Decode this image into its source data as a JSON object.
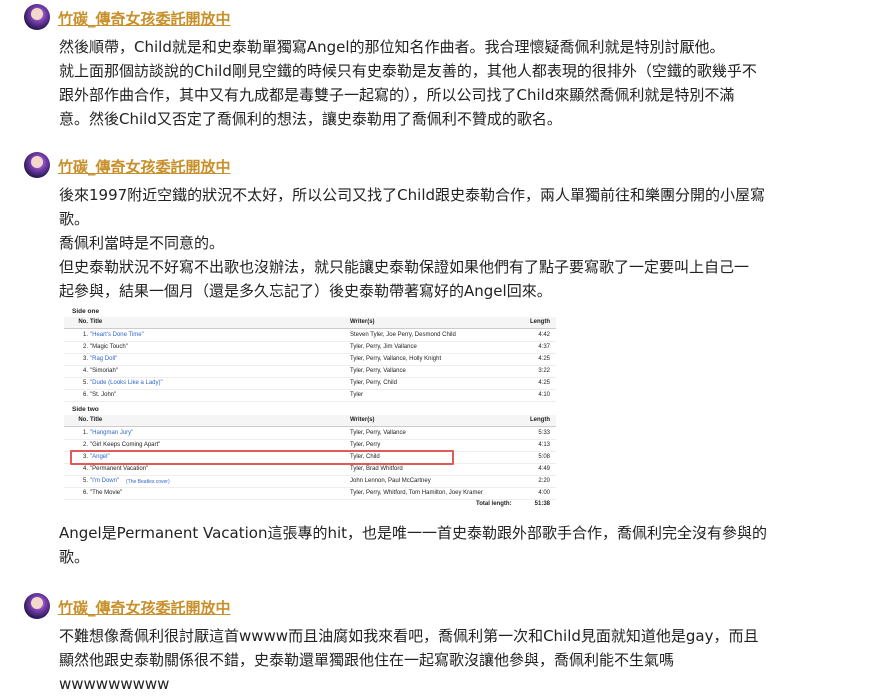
{
  "posts": [
    {
      "author": "竹碳_傳奇女孩委託開放中",
      "paragraphs": [
        "然後順帶，Child就是和史泰勒單獨寫Angel的那位知名作曲者。我合理懷疑喬佩利就是特別討厭他。",
        "就上面那個訪談說的Child剛見空鐵的時候只有史泰勒是友善的，其他人都表現的很排外（空鐵的歌幾乎不",
        "跟外部作曲合作，其中又有九成都是毒雙子一起寫的），所以公司找了Child來顯然喬佩利就是特別不滿",
        "意。然後Child又否定了喬佩利的想法，讓史泰勒用了喬佩利不贊成的歌名。"
      ]
    },
    {
      "author": "竹碳_傳奇女孩委託開放中",
      "paragraphs": [
        "後來1997附近空鐵的狀況不太好，所以公司又找了Child跟史泰勒合作，兩人單獨前往和樂團分開的小屋寫",
        "歌。",
        "喬佩利當時是不同意的。",
        "但史泰勒狀況不好寫不出歌也沒辦法，就只能讓史泰勒保證如果他們有了點子要寫歌了一定要叫上自己一",
        "起參與，結果一個月（還是多久忘記了）後史泰勒帶著寫好的Angel回來。"
      ],
      "after_image": [
        "Angel是Permanent Vacation這張專的hit，也是唯一一首史泰勒跟外部歌手合作，喬佩利完全沒有參與的",
        "歌。"
      ],
      "tracklist": {
        "side_one_label": "Side one",
        "side_two_label": "Side two",
        "headers": {
          "no": "No.",
          "title": "Title",
          "writers": "Writer(s)",
          "length": "Length"
        },
        "side_one": [
          {
            "no": "1.",
            "title": "\"Heart's Done Time\"",
            "writers": "Steven Tyler, Joe Perry, Desmond Child",
            "length": "4:42",
            "linked": true
          },
          {
            "no": "2.",
            "title": "\"Magic Touch\"",
            "writers": "Tyler, Perry, Jim Vallance",
            "length": "4:37",
            "linked": false
          },
          {
            "no": "3.",
            "title": "\"Rag Doll\"",
            "writers": "Tyler, Perry, Vallance, Holly Knight",
            "length": "4:25",
            "linked": true
          },
          {
            "no": "4.",
            "title": "\"Simoriah\"",
            "writers": "Tyler, Perry, Vallance",
            "length": "3:22",
            "linked": false
          },
          {
            "no": "5.",
            "title": "\"Dude (Looks Like a Lady)\"",
            "writers": "Tyler, Perry, Child",
            "length": "4:25",
            "linked": true
          },
          {
            "no": "6.",
            "title": "\"St. John\"",
            "writers": "Tyler",
            "length": "4:10",
            "linked": false
          }
        ],
        "side_two": [
          {
            "no": "1.",
            "title": "\"Hangman Jury\"",
            "writers": "Tyler, Perry, Vallance",
            "length": "5:33",
            "linked": true
          },
          {
            "no": "2.",
            "title": "\"Girl Keeps Coming Apart\"",
            "writers": "Tyler, Perry",
            "length": "4:13",
            "linked": false
          },
          {
            "no": "3.",
            "title": "\"Angel\"",
            "writers": "Tyler, Child",
            "length": "5:08",
            "linked": true
          },
          {
            "no": "4.",
            "title": "\"Permanent Vacation\"",
            "writers": "Tyler, Brad Whitford",
            "length": "4:49",
            "linked": false
          },
          {
            "no": "5.",
            "title": "\"I'm Down\"",
            "note": "(The Beatles cover)",
            "writers": "John Lennon, Paul McCartney",
            "length": "2:20",
            "linked": true
          },
          {
            "no": "6.",
            "title": "\"The Movie\"",
            "writers": "Tyler, Perry, Whitford, Tom Hamilton, Joey Kramer",
            "length": "4:00",
            "linked": false
          }
        ],
        "total_label": "Total length:",
        "total_value": "51:38"
      }
    },
    {
      "author": "竹碳_傳奇女孩委託開放中",
      "paragraphs": [
        "不難想像喬佩利很討厭這首wwww而且油腐如我來看吧，喬佩利第一次和Child見面就知道他是gay，而且",
        "顯然他跟史泰勒關係很不錯，史泰勒還單獨跟他住在一起寫歌沒讓他參與，喬佩利能不生氣嗎",
        "wwwwwwwww"
      ]
    }
  ]
}
